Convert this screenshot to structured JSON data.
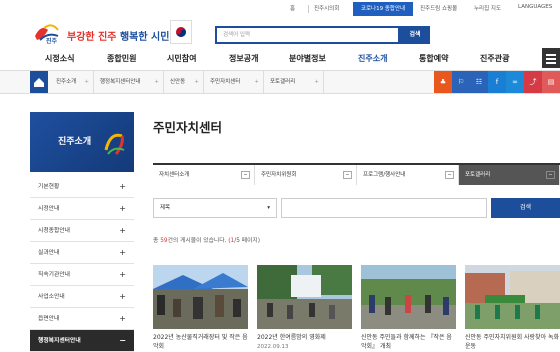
{
  "utility": {
    "home": "홈",
    "council": "진주시의회",
    "covid": "코로나19 종합안내",
    "mall": "진주드림 쇼핑몰",
    "sitemap": "누리집 지도",
    "languages": "LANGUAGES"
  },
  "header": {
    "logo_text": "진주",
    "slogan_red": "부강한 진주",
    "slogan_blue": "행복한 시민",
    "search_placeholder": "검색어 입력",
    "search_button": "검색"
  },
  "gnb": [
    "시정소식",
    "종합민원",
    "시민참여",
    "정보공개",
    "분야별정보",
    "진주소개",
    "통합예약",
    "진주관광"
  ],
  "location": {
    "crumbs": [
      "진주소개",
      "행정복지센터안내",
      "신안동",
      "주민자치센터",
      "포토갤러리"
    ],
    "tool_colors": [
      "#e8571e",
      "#2a63b8",
      "#2a63b8",
      "#1a7fd4",
      "#1c8ad9",
      "#d63b45",
      "#e05a5a"
    ]
  },
  "side": {
    "title": "진주소개",
    "items": [
      "기본현황",
      "시정안내",
      "시청종합안내",
      "실과안내",
      "직속기관안내",
      "사업소안내",
      "읍면안내",
      "행정복지센터안내"
    ]
  },
  "content": {
    "title": "주민자치센터",
    "tabs": [
      "자치센터소개",
      "주민자치위원회",
      "프로그램/행사안내",
      "포토갤러리"
    ],
    "select_value": "제목",
    "search_button": "검색",
    "count_prefix": "총 ",
    "count_num": "59",
    "count_suffix": "건의 게시물이 있습니다. (",
    "page_cur": "1",
    "page_rest": "/5 페이지)"
  },
  "gallery": [
    {
      "caption": "2022년 농산물직거래장터 및 작은 음악회"
    },
    {
      "caption": "2022년 한여름밤의 영화제"
    },
    {
      "caption": "신안동 주민들과 함께하는 『작은 음악회』 개최"
    },
    {
      "caption": "신안동 주민자치위원회 사랑찾아 녹화운동"
    }
  ],
  "gallery_date": "2022.09.13"
}
